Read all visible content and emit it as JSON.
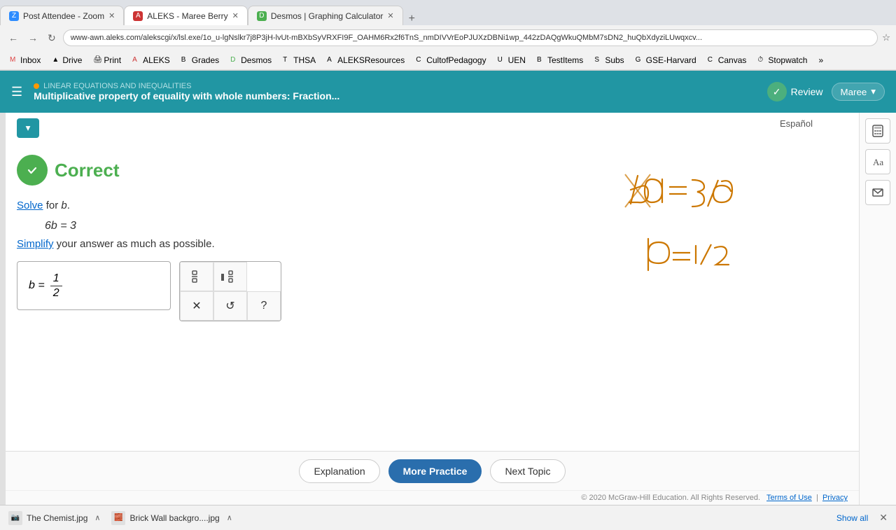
{
  "browser": {
    "tabs": [
      {
        "label": "Post Attendee - Zoom",
        "icon": "Z",
        "iconBg": "#2d8cff",
        "active": false
      },
      {
        "label": "ALEKS - Maree Berry",
        "icon": "A",
        "iconBg": "#cc3333",
        "active": true
      },
      {
        "label": "Desmos | Graphing Calculator",
        "icon": "D",
        "iconBg": "#4caf50",
        "active": false
      }
    ],
    "address": "www-awn.aleks.com/alekscgi/x/lsl.exe/1o_u-lgNslkr7j8P3jH-lvUt-mBXbSyVRXFI9F_OAHM6Rx2f6TnS_nmDIVVrEoPJUXzDBNi1wp_442zDAQgWkuQMbM7sDN2_huQbXdyziLUwqxcv...",
    "bookmarks": [
      {
        "label": "Inbox",
        "icon": "M"
      },
      {
        "label": "Drive",
        "icon": "▲"
      },
      {
        "label": "Print",
        "icon": "🖨"
      },
      {
        "label": "ALEKS",
        "icon": "A"
      },
      {
        "label": "Grades",
        "icon": "B"
      },
      {
        "label": "Desmos",
        "icon": "D"
      },
      {
        "label": "THSA",
        "icon": "T"
      },
      {
        "label": "ALEKSResources",
        "icon": "A"
      },
      {
        "label": "CultofPedagogy",
        "icon": "C"
      },
      {
        "label": "UEN",
        "icon": "U"
      },
      {
        "label": "TestItems",
        "icon": "B"
      },
      {
        "label": "Subs",
        "icon": "S"
      },
      {
        "label": "GSE-Harvard",
        "icon": "G"
      },
      {
        "label": "Canvas",
        "icon": "C"
      },
      {
        "label": "Stopwatch",
        "icon": "⏱"
      },
      {
        "label": "»",
        "icon": ""
      }
    ]
  },
  "header": {
    "topic_label": "LINEAR EQUATIONS AND INEQUALITIES",
    "title": "Multiplicative property of equality with whole numbers: Fraction...",
    "review_label": "Review",
    "user_label": "Maree"
  },
  "espanol": "Español",
  "content": {
    "correct_label": "Correct",
    "solve_text": "Solve",
    "for_text": " for ",
    "variable": "b",
    "period": ".",
    "equation": "6b = 3",
    "simplify_link": "Simplify",
    "simplify_rest": " your answer as much as possible.",
    "answer_prefix": "b  =",
    "answer_num": "1",
    "answer_den": "2"
  },
  "keypad": {
    "row1": [
      "fraction",
      "mixed"
    ],
    "row2": [
      "clear",
      "undo",
      "help"
    ]
  },
  "footer": {
    "explanation_label": "Explanation",
    "practice_label": "More Practice",
    "next_label": "Next Topic"
  },
  "copyright": "© 2020 McGraw-Hill Education. All Rights Reserved.",
  "terms_label": "Terms of Use",
  "privacy_label": "Privacy",
  "downloads": [
    {
      "name": "The Chemist.jpg"
    },
    {
      "name": "Brick Wall backgro....jpg"
    }
  ],
  "show_all": "Show all"
}
